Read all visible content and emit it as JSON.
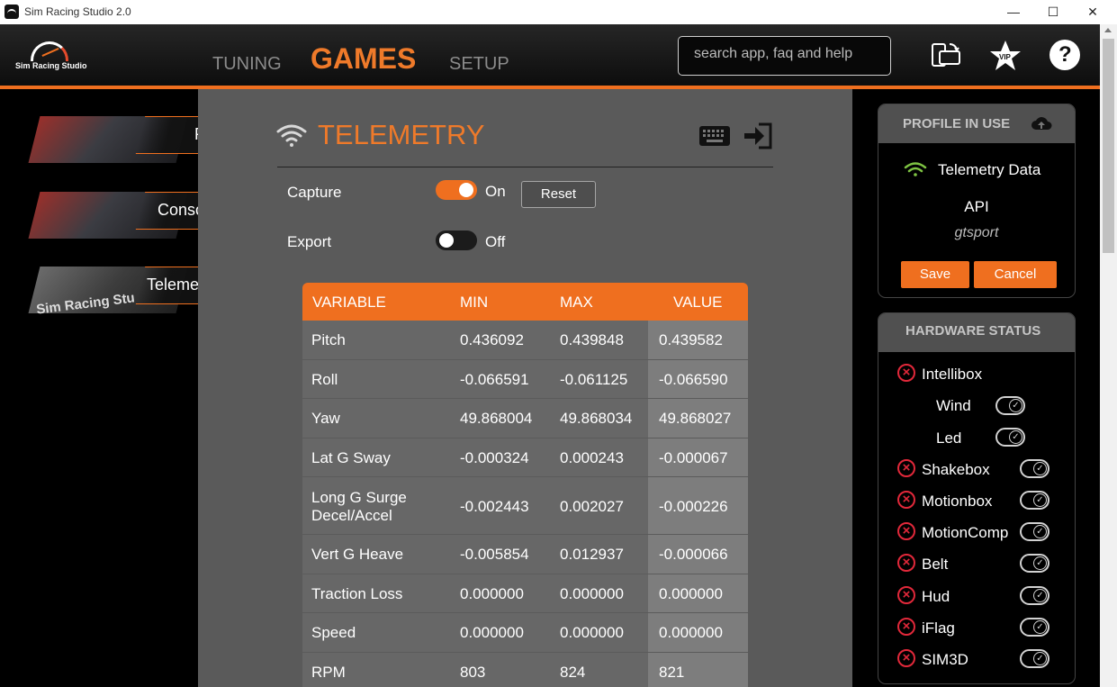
{
  "window": {
    "title": "Sim Racing Studio 2.0",
    "minimize": "—",
    "maximize": "☐",
    "close": "✕"
  },
  "logo": {
    "text": "Sim Racing Studio"
  },
  "nav": {
    "tuning": "TUNING",
    "games": "GAMES",
    "setup": "SETUP"
  },
  "search": {
    "placeholder": "search app, faq and help"
  },
  "header_icons": [
    "device-sync-icon",
    "vip-star-icon",
    "help-icon"
  ],
  "vip_label": "VIP",
  "help_label": "?",
  "sidebar": {
    "items": [
      {
        "label": "PC"
      },
      {
        "label": "Console"
      },
      {
        "label": "Telemetry"
      }
    ],
    "telemetry_thumb_text": "Sim Racing Stu"
  },
  "telemetry": {
    "title": "TELEMETRY",
    "capture": {
      "label": "Capture",
      "state": "On"
    },
    "export": {
      "label": "Export",
      "state": "Off"
    },
    "reset_label": "Reset",
    "headers": [
      "VARIABLE",
      "MIN",
      "MAX",
      "VALUE"
    ],
    "rows": [
      [
        "Pitch",
        "0.436092",
        "0.439848",
        "0.439582"
      ],
      [
        "Roll",
        "-0.066591",
        "-0.061125",
        "-0.066590"
      ],
      [
        "Yaw",
        "49.868004",
        "49.868034",
        "49.868027"
      ],
      [
        "Lat G Sway",
        "-0.000324",
        "0.000243",
        "-0.000067"
      ],
      [
        "Long G Surge Decel/Accel",
        "-0.002443",
        "0.002027",
        "-0.000226"
      ],
      [
        "Vert G Heave",
        "-0.005854",
        "0.012937",
        "-0.000066"
      ],
      [
        "Traction Loss",
        "0.000000",
        "0.000000",
        "0.000000"
      ],
      [
        "Speed",
        "0.000000",
        "0.000000",
        "0.000000"
      ],
      [
        "RPM",
        "803",
        "824",
        "821"
      ]
    ]
  },
  "profile": {
    "heading": "PROFILE IN USE",
    "name": "Telemetry Data",
    "api": "API",
    "game": "gtsport",
    "save_label": "Save",
    "cancel_label": "Cancel"
  },
  "hardware": {
    "heading": "HARDWARE STATUS",
    "items": [
      {
        "name": "Intellibox"
      },
      {
        "name": "Wind"
      },
      {
        "name": "Led"
      },
      {
        "name": "Shakebox"
      },
      {
        "name": "Motionbox"
      },
      {
        "name": "MotionComp"
      },
      {
        "name": "Belt"
      },
      {
        "name": "Hud"
      },
      {
        "name": "iFlag"
      },
      {
        "name": "SIM3D"
      }
    ]
  },
  "colors": {
    "accent": "#ef6f1f",
    "error": "#e1283a",
    "wifi_green": "#7dc242"
  }
}
